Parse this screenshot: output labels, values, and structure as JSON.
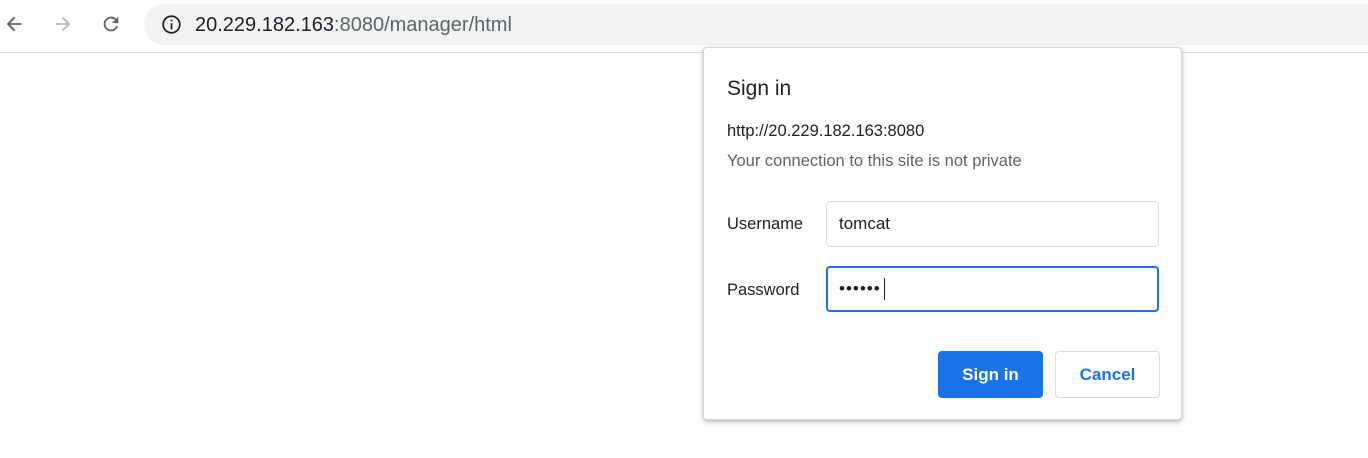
{
  "browser": {
    "url_host": "20.229.182.163",
    "url_path": ":8080/manager/html",
    "icons": {
      "back": "arrow-left-icon",
      "forward": "arrow-right-icon",
      "reload": "reload-icon",
      "site_info": "info-icon"
    }
  },
  "dialog": {
    "title": "Sign in",
    "origin": "http://20.229.182.163:8080",
    "privacy_note": "Your connection to this site is not private",
    "username_label": "Username",
    "username_value": "tomcat",
    "password_label": "Password",
    "password_value": "••••••",
    "signin_label": "Sign in",
    "cancel_label": "Cancel"
  },
  "colors": {
    "accent": "#1a73e8",
    "omnibox_bg": "#f1f3f4",
    "text_primary": "#202124",
    "text_secondary": "#5f6368"
  }
}
